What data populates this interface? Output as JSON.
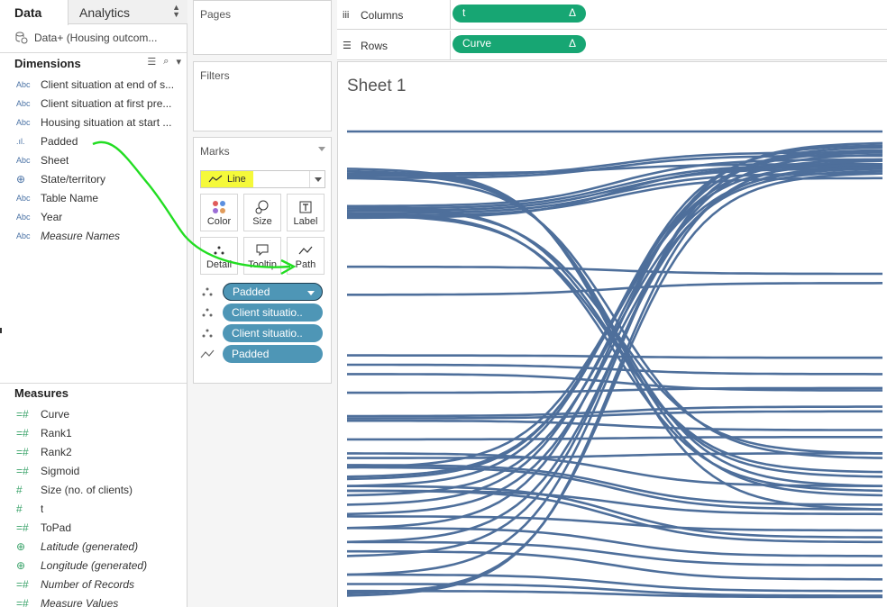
{
  "tabs": {
    "data": "Data",
    "analytics": "Analytics"
  },
  "datasource": "Data+ (Housing outcom...",
  "dimensions": {
    "title": "Dimensions",
    "items": [
      {
        "type": "Abc",
        "label": "Client situation at end of s...",
        "italic": false
      },
      {
        "type": "Abc",
        "label": "Client situation at first pre...",
        "italic": false
      },
      {
        "type": "Abc",
        "label": "Housing situation at start ...",
        "italic": false
      },
      {
        "type": "bin",
        "label": "Padded",
        "italic": false
      },
      {
        "type": "Abc",
        "label": "Sheet",
        "italic": false
      },
      {
        "type": "globe",
        "label": "State/territory",
        "italic": false
      },
      {
        "type": "Abc",
        "label": "Table Name",
        "italic": false
      },
      {
        "type": "Abc",
        "label": "Year",
        "italic": false
      },
      {
        "type": "Abc",
        "label": "Measure Names",
        "italic": true
      }
    ]
  },
  "measures": {
    "title": "Measures",
    "items": [
      {
        "type": "calc",
        "label": "Curve",
        "italic": false
      },
      {
        "type": "calc",
        "label": "Rank1",
        "italic": false
      },
      {
        "type": "calc",
        "label": "Rank2",
        "italic": false
      },
      {
        "type": "calc",
        "label": "Sigmoid",
        "italic": false
      },
      {
        "type": "num",
        "label": "Size (no. of clients)",
        "italic": false
      },
      {
        "type": "num",
        "label": "t",
        "italic": false
      },
      {
        "type": "calc",
        "label": "ToPad",
        "italic": false
      },
      {
        "type": "globe",
        "label": "Latitude (generated)",
        "italic": true
      },
      {
        "type": "globe",
        "label": "Longitude (generated)",
        "italic": true
      },
      {
        "type": "calc",
        "label": "Number of Records",
        "italic": true
      },
      {
        "type": "calc",
        "label": "Measure Values",
        "italic": true
      }
    ]
  },
  "cards": {
    "pages": "Pages",
    "filters": "Filters",
    "marks": "Marks"
  },
  "marks": {
    "mark_type": "Line",
    "buttons": {
      "color": "Color",
      "size": "Size",
      "label": "Label",
      "detail": "Detail",
      "tooltip": "Tooltip",
      "path": "Path"
    },
    "pills": [
      {
        "icon": "detail-icon",
        "label": "Padded"
      },
      {
        "icon": "detail-icon",
        "label": "Client situatio.."
      },
      {
        "icon": "detail-icon",
        "label": "Client situatio.."
      },
      {
        "icon": "path-icon",
        "label": "Padded"
      }
    ]
  },
  "shelves": {
    "columns": {
      "label": "Columns",
      "pill": "t",
      "delta": "Δ"
    },
    "rows": {
      "label": "Rows",
      "pill": "Curve",
      "delta": "Δ"
    }
  },
  "sheet_title": "Sheet 1",
  "colors": {
    "line": "#4e6f9b",
    "pill_blue": "#4e96b6",
    "pill_green": "#17a673",
    "highlight": "#f5f93a",
    "annotation": "#22dd22"
  },
  "chart_data": {
    "type": "line",
    "description_free": true,
    "x_range": [
      0,
      1
    ],
    "series_endpoints": [
      [
        0.0,
        0.0
      ],
      [
        0.09,
        0.07
      ],
      [
        0.095,
        0.045
      ],
      [
        0.1,
        0.052
      ],
      [
        0.16,
        0.06
      ],
      [
        0.165,
        0.072
      ],
      [
        0.17,
        0.08
      ],
      [
        0.175,
        0.09
      ],
      [
        0.18,
        0.1
      ],
      [
        0.185,
        0.075
      ],
      [
        0.29,
        0.305
      ],
      [
        0.35,
        0.325
      ],
      [
        0.48,
        0.485
      ],
      [
        0.5,
        0.52
      ],
      [
        0.52,
        0.555
      ],
      [
        0.56,
        0.55
      ],
      [
        0.61,
        0.59
      ],
      [
        0.615,
        0.6
      ],
      [
        0.62,
        0.64
      ],
      [
        0.66,
        0.655
      ],
      [
        0.7,
        0.69
      ],
      [
        0.69,
        0.76
      ],
      [
        0.715,
        0.8
      ],
      [
        0.72,
        0.81
      ],
      [
        0.77,
        0.82
      ],
      [
        0.76,
        0.87
      ],
      [
        0.77,
        0.88
      ],
      [
        0.825,
        0.855
      ],
      [
        0.85,
        0.91
      ],
      [
        0.88,
        0.93
      ],
      [
        0.9,
        0.96
      ],
      [
        0.95,
        0.985
      ],
      [
        0.97,
        0.995
      ],
      [
        0.985,
        0.998
      ],
      [
        0.08,
        0.81
      ],
      [
        0.085,
        0.78
      ],
      [
        0.09,
        0.76
      ],
      [
        0.1,
        0.7
      ],
      [
        0.16,
        0.74
      ],
      [
        0.165,
        0.69
      ],
      [
        0.175,
        0.77
      ],
      [
        0.18,
        0.73
      ],
      [
        0.745,
        0.045
      ],
      [
        0.74,
        0.06
      ],
      [
        0.76,
        0.03
      ],
      [
        0.72,
        0.07
      ],
      [
        0.78,
        0.08
      ],
      [
        0.8,
        0.04
      ],
      [
        0.82,
        0.085
      ],
      [
        0.85,
        0.025
      ],
      [
        0.88,
        0.075
      ],
      [
        0.91,
        0.05
      ],
      [
        0.95,
        0.034
      ],
      [
        0.99,
        0.09
      ],
      [
        0.995,
        0.063
      ]
    ]
  }
}
